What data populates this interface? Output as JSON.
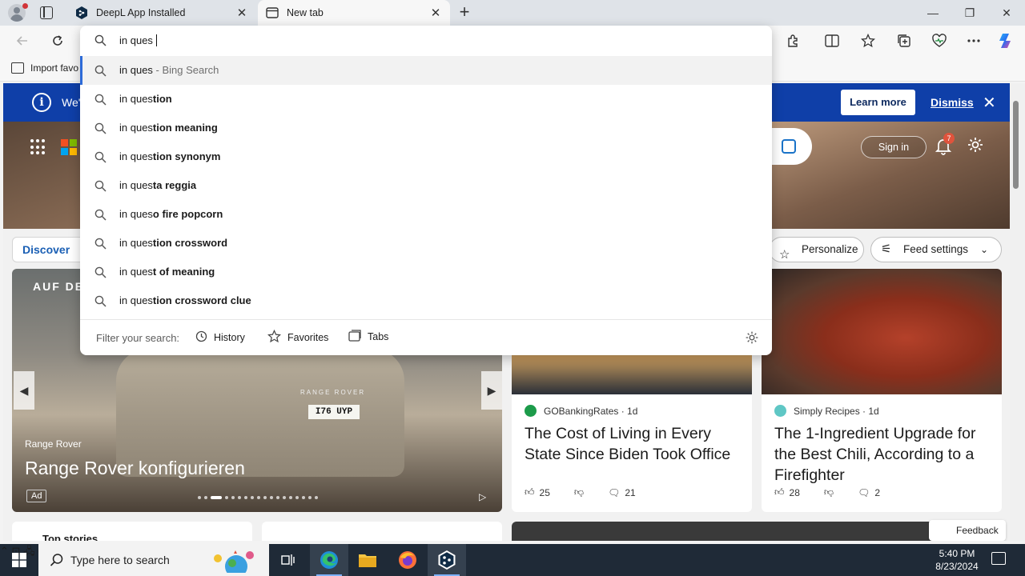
{
  "browser": {
    "tabs": [
      {
        "title": "DeepL App Installed",
        "close": "✕"
      },
      {
        "title": "New tab",
        "close": "✕"
      }
    ],
    "new_tab": "+",
    "window": {
      "minimize": "—",
      "restore": "❐",
      "close": "✕"
    },
    "favorites_bar": {
      "import_label": "Import favo"
    }
  },
  "omnibox": {
    "query": "in ques",
    "suggestions": [
      {
        "prefix": "in ques",
        "suffix": "",
        "hint": " - Bing Search"
      },
      {
        "prefix": "in ques",
        "suffix": "tion",
        "hint": ""
      },
      {
        "prefix": "in ques",
        "suffix": "tion meaning",
        "hint": ""
      },
      {
        "prefix": "in ques",
        "suffix": "tion synonym",
        "hint": ""
      },
      {
        "prefix": "in ques",
        "suffix": "ta reggia",
        "hint": ""
      },
      {
        "prefix": "in ques",
        "suffix": "o fire popcorn",
        "hint": ""
      },
      {
        "prefix": "in ques",
        "suffix": "tion crossword",
        "hint": ""
      },
      {
        "prefix": "in ques",
        "suffix": "t of meaning",
        "hint": ""
      },
      {
        "prefix": "in ques",
        "suffix": "tion crossword clue",
        "hint": ""
      }
    ],
    "filter_label": "Filter your search:",
    "filters": [
      "History",
      "Favorites",
      "Tabs"
    ]
  },
  "ntp": {
    "notice": {
      "text": "We'",
      "learn_more": "Learn more",
      "dismiss": "Dismiss",
      "close": "✕"
    },
    "header": {
      "sign_in": "Sign in",
      "notification_count": "7"
    },
    "feed": {
      "discover": "Discover",
      "personalize": "Personalize",
      "feed_settings": "Feed settings"
    },
    "ad": {
      "top_text": "AUF DE",
      "brand": "Range Rover",
      "title": "Range Rover konfigurieren",
      "badge": "Ad",
      "badge_on_car": "RANGE ROVER",
      "plate": "I76 UYP"
    },
    "cards": [
      {
        "source": "GOBankingRates · 1d",
        "title": "The Cost of Living in Every State Since Biden Took Office",
        "likes": "25",
        "comments": "21"
      },
      {
        "source": "Simply Recipes · 1d",
        "title": "The 1-Ingredient Upgrade for the Best Chili, According to a Firefighter",
        "likes": "28",
        "comments": "2"
      }
    ],
    "top_stories": "Top stories",
    "feedback": "Feedback"
  },
  "taskbar": {
    "search_placeholder": "Type here to search",
    "time": "5:40 PM",
    "date": "8/23/2024"
  },
  "colors": {
    "accent": "#2d6bd8",
    "notice_bg": "#0f3fa8",
    "taskbar_bg": "#1f2a37"
  }
}
